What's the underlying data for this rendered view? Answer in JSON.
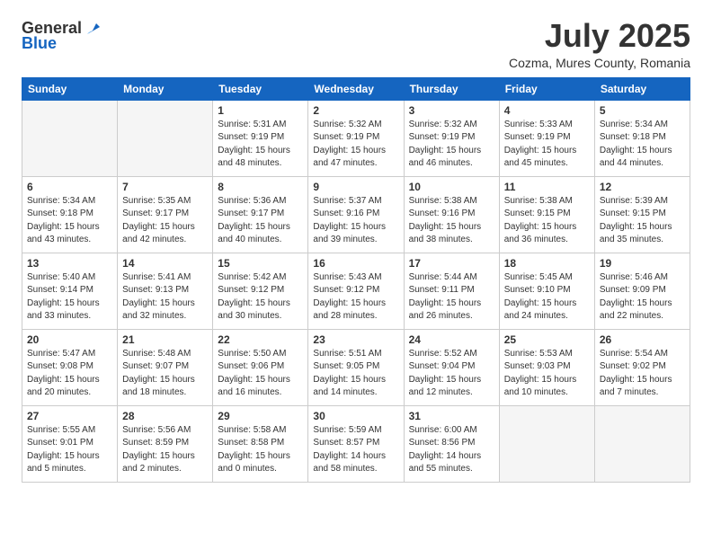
{
  "logo": {
    "general": "General",
    "blue": "Blue"
  },
  "title": "July 2025",
  "subtitle": "Cozma, Mures County, Romania",
  "days_of_week": [
    "Sunday",
    "Monday",
    "Tuesday",
    "Wednesday",
    "Thursday",
    "Friday",
    "Saturday"
  ],
  "weeks": [
    [
      {
        "day": "",
        "info": ""
      },
      {
        "day": "",
        "info": ""
      },
      {
        "day": "1",
        "info": "Sunrise: 5:31 AM\nSunset: 9:19 PM\nDaylight: 15 hours\nand 48 minutes."
      },
      {
        "day": "2",
        "info": "Sunrise: 5:32 AM\nSunset: 9:19 PM\nDaylight: 15 hours\nand 47 minutes."
      },
      {
        "day": "3",
        "info": "Sunrise: 5:32 AM\nSunset: 9:19 PM\nDaylight: 15 hours\nand 46 minutes."
      },
      {
        "day": "4",
        "info": "Sunrise: 5:33 AM\nSunset: 9:19 PM\nDaylight: 15 hours\nand 45 minutes."
      },
      {
        "day": "5",
        "info": "Sunrise: 5:34 AM\nSunset: 9:18 PM\nDaylight: 15 hours\nand 44 minutes."
      }
    ],
    [
      {
        "day": "6",
        "info": "Sunrise: 5:34 AM\nSunset: 9:18 PM\nDaylight: 15 hours\nand 43 minutes."
      },
      {
        "day": "7",
        "info": "Sunrise: 5:35 AM\nSunset: 9:17 PM\nDaylight: 15 hours\nand 42 minutes."
      },
      {
        "day": "8",
        "info": "Sunrise: 5:36 AM\nSunset: 9:17 PM\nDaylight: 15 hours\nand 40 minutes."
      },
      {
        "day": "9",
        "info": "Sunrise: 5:37 AM\nSunset: 9:16 PM\nDaylight: 15 hours\nand 39 minutes."
      },
      {
        "day": "10",
        "info": "Sunrise: 5:38 AM\nSunset: 9:16 PM\nDaylight: 15 hours\nand 38 minutes."
      },
      {
        "day": "11",
        "info": "Sunrise: 5:38 AM\nSunset: 9:15 PM\nDaylight: 15 hours\nand 36 minutes."
      },
      {
        "day": "12",
        "info": "Sunrise: 5:39 AM\nSunset: 9:15 PM\nDaylight: 15 hours\nand 35 minutes."
      }
    ],
    [
      {
        "day": "13",
        "info": "Sunrise: 5:40 AM\nSunset: 9:14 PM\nDaylight: 15 hours\nand 33 minutes."
      },
      {
        "day": "14",
        "info": "Sunrise: 5:41 AM\nSunset: 9:13 PM\nDaylight: 15 hours\nand 32 minutes."
      },
      {
        "day": "15",
        "info": "Sunrise: 5:42 AM\nSunset: 9:12 PM\nDaylight: 15 hours\nand 30 minutes."
      },
      {
        "day": "16",
        "info": "Sunrise: 5:43 AM\nSunset: 9:12 PM\nDaylight: 15 hours\nand 28 minutes."
      },
      {
        "day": "17",
        "info": "Sunrise: 5:44 AM\nSunset: 9:11 PM\nDaylight: 15 hours\nand 26 minutes."
      },
      {
        "day": "18",
        "info": "Sunrise: 5:45 AM\nSunset: 9:10 PM\nDaylight: 15 hours\nand 24 minutes."
      },
      {
        "day": "19",
        "info": "Sunrise: 5:46 AM\nSunset: 9:09 PM\nDaylight: 15 hours\nand 22 minutes."
      }
    ],
    [
      {
        "day": "20",
        "info": "Sunrise: 5:47 AM\nSunset: 9:08 PM\nDaylight: 15 hours\nand 20 minutes."
      },
      {
        "day": "21",
        "info": "Sunrise: 5:48 AM\nSunset: 9:07 PM\nDaylight: 15 hours\nand 18 minutes."
      },
      {
        "day": "22",
        "info": "Sunrise: 5:50 AM\nSunset: 9:06 PM\nDaylight: 15 hours\nand 16 minutes."
      },
      {
        "day": "23",
        "info": "Sunrise: 5:51 AM\nSunset: 9:05 PM\nDaylight: 15 hours\nand 14 minutes."
      },
      {
        "day": "24",
        "info": "Sunrise: 5:52 AM\nSunset: 9:04 PM\nDaylight: 15 hours\nand 12 minutes."
      },
      {
        "day": "25",
        "info": "Sunrise: 5:53 AM\nSunset: 9:03 PM\nDaylight: 15 hours\nand 10 minutes."
      },
      {
        "day": "26",
        "info": "Sunrise: 5:54 AM\nSunset: 9:02 PM\nDaylight: 15 hours\nand 7 minutes."
      }
    ],
    [
      {
        "day": "27",
        "info": "Sunrise: 5:55 AM\nSunset: 9:01 PM\nDaylight: 15 hours\nand 5 minutes."
      },
      {
        "day": "28",
        "info": "Sunrise: 5:56 AM\nSunset: 8:59 PM\nDaylight: 15 hours\nand 2 minutes."
      },
      {
        "day": "29",
        "info": "Sunrise: 5:58 AM\nSunset: 8:58 PM\nDaylight: 15 hours\nand 0 minutes."
      },
      {
        "day": "30",
        "info": "Sunrise: 5:59 AM\nSunset: 8:57 PM\nDaylight: 14 hours\nand 58 minutes."
      },
      {
        "day": "31",
        "info": "Sunrise: 6:00 AM\nSunset: 8:56 PM\nDaylight: 14 hours\nand 55 minutes."
      },
      {
        "day": "",
        "info": ""
      },
      {
        "day": "",
        "info": ""
      }
    ]
  ]
}
